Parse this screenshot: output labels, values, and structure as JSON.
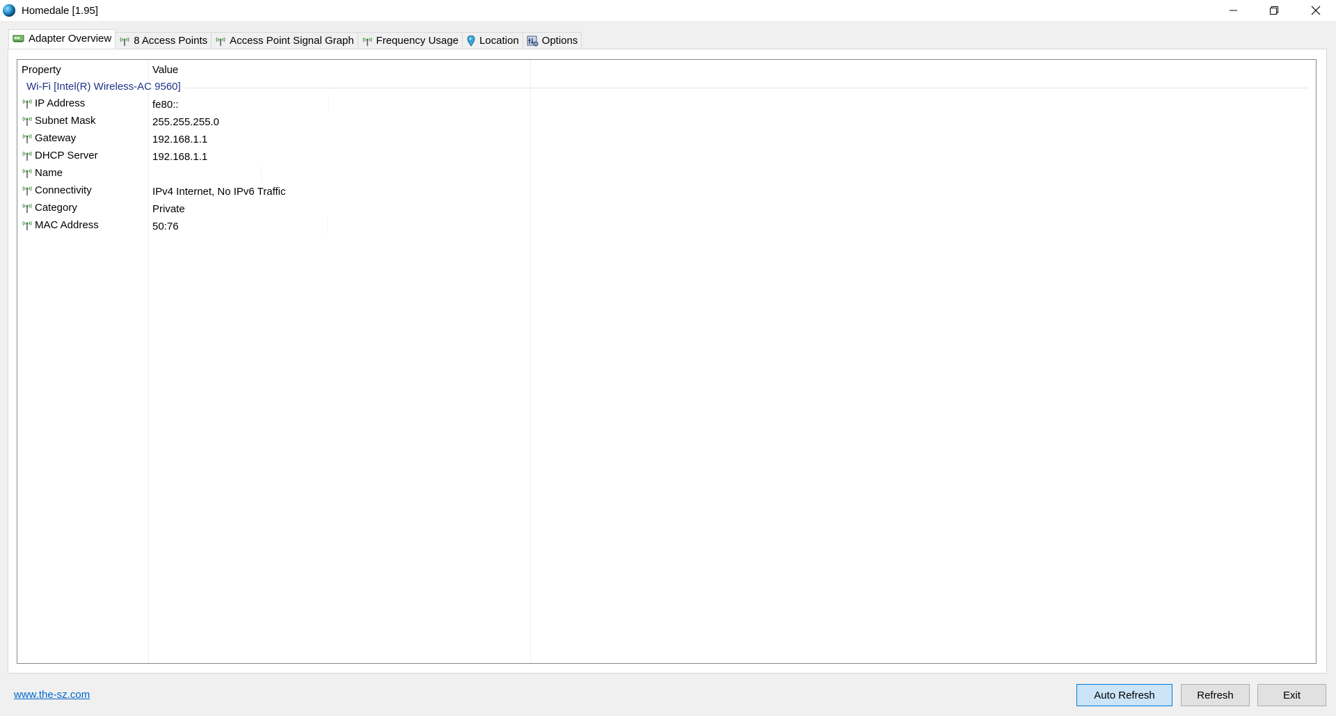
{
  "window": {
    "title": "Homedale [1.95]"
  },
  "tabs": [
    {
      "label": "Adapter Overview",
      "icon": "adapter-icon",
      "active": true
    },
    {
      "label": "8 Access Points",
      "icon": "antenna-icon",
      "active": false
    },
    {
      "label": "Access Point Signal Graph",
      "icon": "antenna-icon",
      "active": false
    },
    {
      "label": "Frequency Usage",
      "icon": "antenna-icon",
      "active": false
    },
    {
      "label": "Location",
      "icon": "location-pin-icon",
      "active": false
    },
    {
      "label": "Options",
      "icon": "options-icon",
      "active": false
    }
  ],
  "list": {
    "headers": {
      "property": "Property",
      "value": "Value"
    },
    "group": "Wi-Fi [Intel(R) Wireless-AC 9560]",
    "rows": [
      {
        "property": "IP Address",
        "value": "fe80::"
      },
      {
        "property": "Subnet Mask",
        "value": "255.255.255.0"
      },
      {
        "property": "Gateway",
        "value": "192.168.1.1"
      },
      {
        "property": "DHCP Server",
        "value": "192.168.1.1"
      },
      {
        "property": "Name",
        "value": ""
      },
      {
        "property": "Connectivity",
        "value": "IPv4 Internet, No IPv6 Traffic"
      },
      {
        "property": "Category",
        "value": "Private"
      },
      {
        "property": "MAC Address",
        "value": "50:76"
      }
    ]
  },
  "footer": {
    "link": "www.the-sz.com",
    "auto_refresh_label": "Auto Refresh",
    "refresh_label": "Refresh",
    "exit_label": "Exit"
  },
  "colors": {
    "group_text": "#1e3287",
    "link": "#0066cc",
    "primary_button_bg": "#cce4f7",
    "primary_button_border": "#0078d7",
    "antenna_green": "#3a8a3a"
  }
}
